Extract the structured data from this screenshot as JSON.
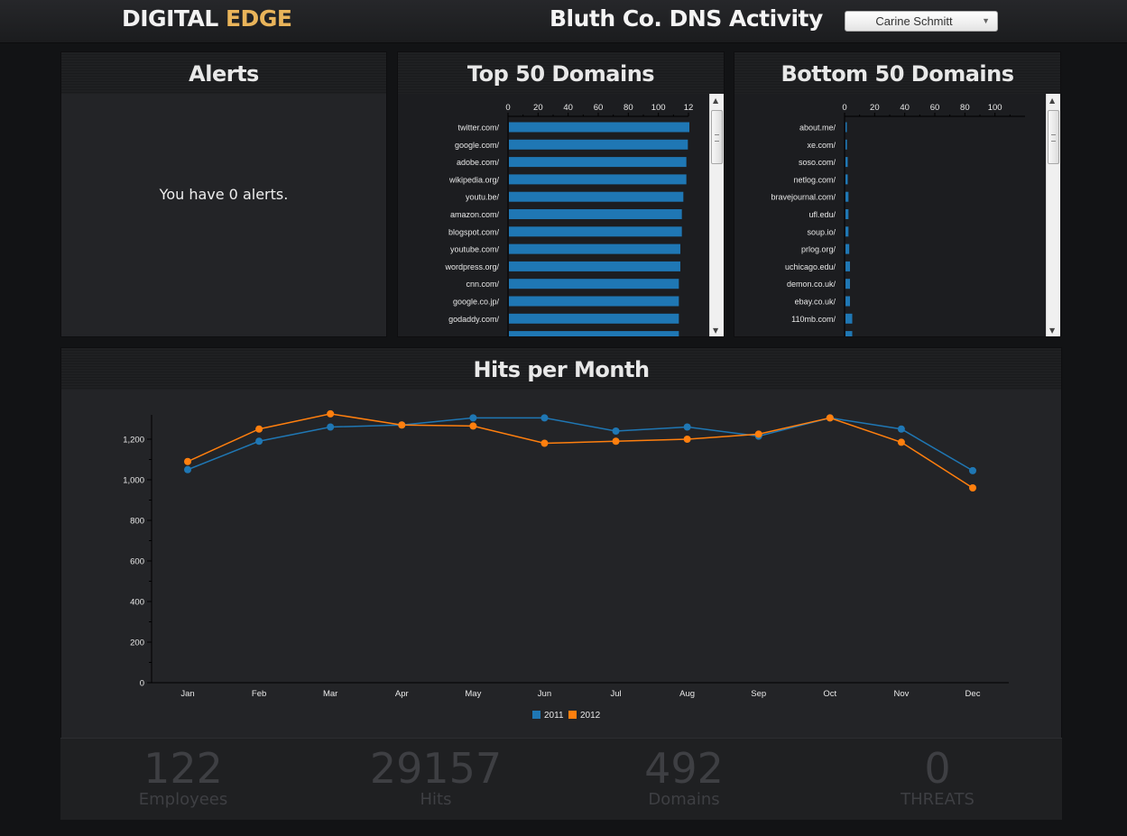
{
  "brand": {
    "part1": "DIGITAL ",
    "part2": "EDGE"
  },
  "page_title": "Bluth Co. DNS Activity",
  "user_select": {
    "value": "Carine Schmitt"
  },
  "alerts": {
    "title": "Alerts",
    "message": "You have 0 alerts."
  },
  "top_domains": {
    "title": "Top 50 Domains",
    "chart_data": {
      "type": "bar",
      "orientation": "horizontal",
      "categories": [
        "twitter.com/",
        "google.com/",
        "adobe.com/",
        "wikipedia.org/",
        "youtu.be/",
        "amazon.com/",
        "blogspot.com/",
        "youtube.com/",
        "wordpress.org/",
        "cnn.com/",
        "google.co.jp/",
        "godaddy.com/"
      ],
      "values": [
        120,
        119,
        118,
        118,
        116,
        115,
        115,
        114,
        114,
        113,
        113,
        113
      ],
      "xticks": [
        "0",
        "20",
        "40",
        "60",
        "80",
        "100",
        "12"
      ],
      "xlim": [
        0,
        120
      ],
      "color": "#1f77b4"
    }
  },
  "bottom_domains": {
    "title": "Bottom 50 Domains",
    "chart_data": {
      "type": "bar",
      "orientation": "horizontal",
      "categories": [
        "about.me/",
        "xe.com/",
        "soso.com/",
        "netlog.com/",
        "bravejournal.com/",
        "ufl.edu/",
        "soup.io/",
        "prlog.org/",
        "uchicago.edu/",
        "demon.co.uk/",
        "ebay.co.uk/",
        "110mb.com/"
      ],
      "values": [
        0.5,
        1,
        1.5,
        1.5,
        2,
        2,
        2,
        2.5,
        3,
        3,
        3,
        4.5
      ],
      "xticks": [
        "0",
        "20",
        "40",
        "60",
        "80",
        "100"
      ],
      "xlim": [
        0,
        120
      ],
      "color": "#1f77b4"
    }
  },
  "hits_per_month": {
    "title": "Hits per Month",
    "chart_data": {
      "type": "line",
      "categories": [
        "Jan",
        "Feb",
        "Mar",
        "Apr",
        "May",
        "Jun",
        "Jul",
        "Aug",
        "Sep",
        "Oct",
        "Nov",
        "Dec"
      ],
      "series": [
        {
          "name": "2011",
          "color": "#1f77b4",
          "values": [
            1050,
            1190,
            1260,
            1270,
            1305,
            1305,
            1240,
            1260,
            1215,
            1305,
            1250,
            1045
          ]
        },
        {
          "name": "2012",
          "color": "#ff7f0e",
          "values": [
            1090,
            1250,
            1325,
            1270,
            1265,
            1180,
            1190,
            1200,
            1225,
            1305,
            1185,
            960
          ]
        }
      ],
      "yticks": [
        "0",
        "200",
        "400",
        "600",
        "800",
        "1,000",
        "1,200"
      ],
      "ylim": [
        0,
        1320
      ],
      "legend": "bottom-center"
    }
  },
  "stats": [
    {
      "value": "122",
      "label": "Employees"
    },
    {
      "value": "29157",
      "label": "Hits"
    },
    {
      "value": "492",
      "label": "Domains"
    },
    {
      "value": "0",
      "label": "THREATS"
    }
  ]
}
